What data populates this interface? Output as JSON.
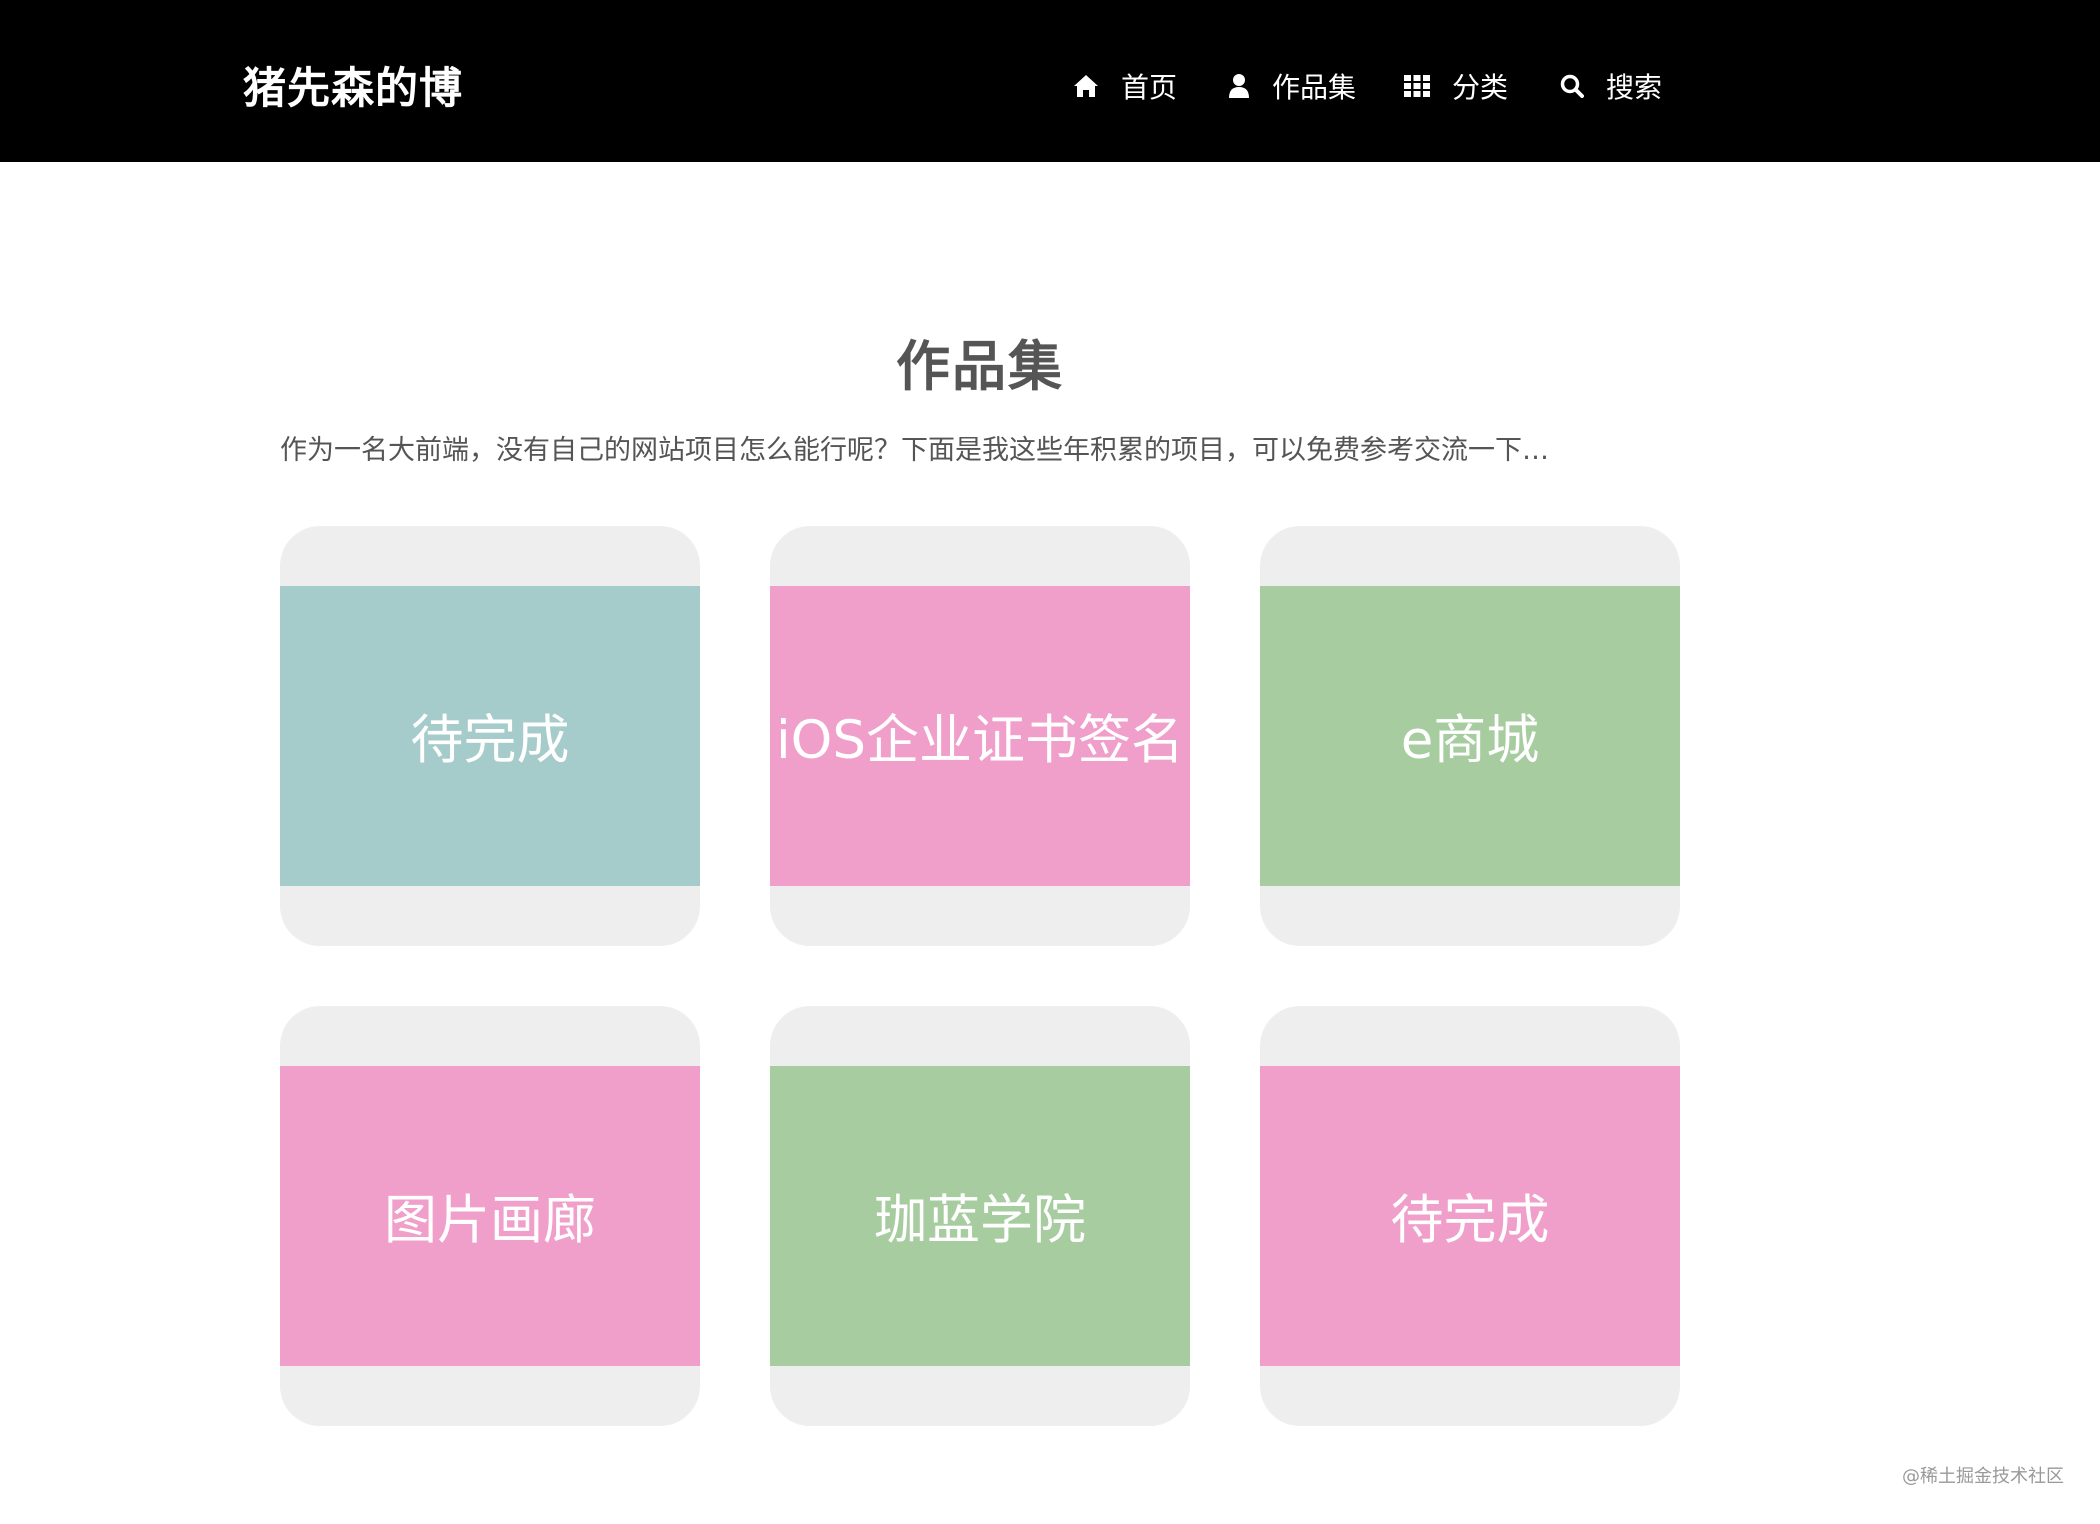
{
  "header": {
    "brand": "猪先森的博",
    "nav": [
      {
        "label": "首页",
        "icon": "home-icon"
      },
      {
        "label": "作品集",
        "icon": "user-icon"
      },
      {
        "label": "分类",
        "icon": "grid-icon"
      },
      {
        "label": "搜索",
        "icon": "search-icon"
      }
    ]
  },
  "main": {
    "title": "作品集",
    "intro": "作为一名大前端，没有自己的网站项目怎么能行呢？下面是我这些年积累的项目，可以免费参考交流一下…",
    "cards": [
      {
        "label": "待完成",
        "color": "#a5cccb"
      },
      {
        "label": "iOS企业证书签名",
        "color": "#f09fcb"
      },
      {
        "label": "e商城",
        "color": "#a7cc9f"
      },
      {
        "label": "图片画廊",
        "color": "#f09fcb"
      },
      {
        "label": "珈蓝学院",
        "color": "#a7cc9f"
      },
      {
        "label": "待完成",
        "color": "#f09fcb"
      }
    ]
  },
  "watermark": "@稀土掘金技术社区",
  "colors": {
    "header_bg": "#000000",
    "card_bg": "#eeeeee",
    "text": "#555555"
  }
}
